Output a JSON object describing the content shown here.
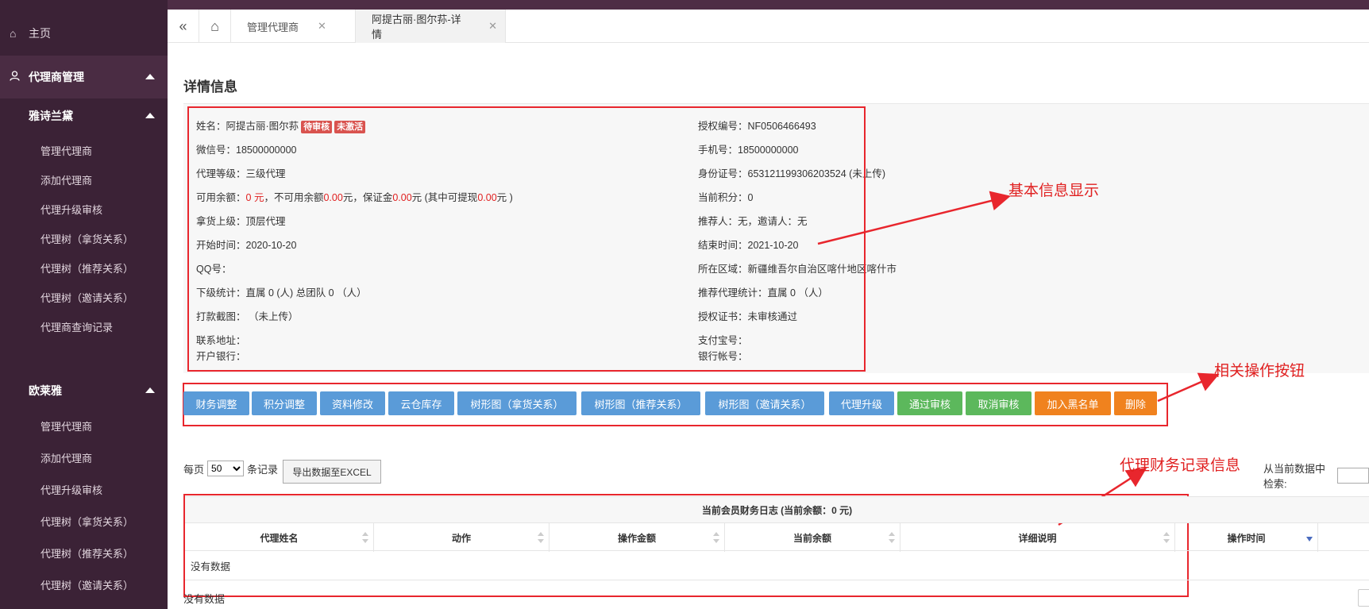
{
  "sidebar": {
    "home": "主页",
    "group": "代理商管理",
    "sub1": {
      "title": "雅诗兰黛",
      "items": [
        "管理代理商",
        "添加代理商",
        "代理升级审核",
        "代理树（拿货关系）",
        "代理树（推荐关系）",
        "代理树（邀请关系）",
        "代理商查询记录"
      ]
    },
    "sub2": {
      "title": "欧莱雅",
      "items": [
        "管理代理商",
        "添加代理商",
        "代理升级审核",
        "代理树（拿货关系）",
        "代理树（推荐关系）",
        "代理树（邀请关系）"
      ]
    }
  },
  "tabs": [
    "管理代理商",
    "阿提古丽·图尔荪-详情"
  ],
  "title": "详情信息",
  "info": {
    "left": {
      "name_label": "姓名：",
      "name": "阿提古丽·图尔荪",
      "badge_audit": "待审核",
      "badge_active": "未激活",
      "wechat": "微信号：18500000000",
      "level": "代理等级：三级代理",
      "balance_pre": "可用余额：",
      "balance_val": "0 元",
      "frozen_pre": "，不可用余额",
      "frozen_val": "0.00",
      "deposit_pre": "元，保证金",
      "deposit_val": "0.00",
      "withdraw_pre": "元 (其中可提现",
      "withdraw_val": "0.00",
      "withdraw_post": "元 )",
      "upline": "拿货上级：顶层代理",
      "start": "开始时间：2020-10-20",
      "qq": "QQ号：",
      "stats": "下级统计：直属 0 (人) 总团队 0 （人）",
      "screenshot": "打款截图：  （未上传）",
      "address": "联系地址：",
      "bank": "开户银行："
    },
    "right": {
      "auth_no": "授权编号：NF0506466493",
      "phone": "手机号：18500000000",
      "idcard": "身份证号：653121199306203524   (未上传)",
      "points": "当前积分：0",
      "referrer": "推荐人：无，邀请人：无",
      "end": "结束时间：2021-10-20",
      "region": "所在区域：新疆维吾尔自治区喀什地区喀什市",
      "ref_stats": "推荐代理统计：直属 0 （人）",
      "cert": "授权证书：未审核通过",
      "alipay": "支付宝号：",
      "bank_account": "银行帐号："
    }
  },
  "buttons": [
    "财务调整",
    "积分调整",
    "资料修改",
    "云仓库存",
    "树形图（拿货关系）",
    "树形图（推荐关系）",
    "树形图（邀请关系）",
    "代理升级",
    "通过审核",
    "取消审核",
    "加入黑名单",
    "删除"
  ],
  "notes": {
    "basic": "基本信息显示",
    "actions": "相关操作按钮",
    "finance": "代理财务记录信息"
  },
  "table": {
    "perpage_pre": "每页",
    "perpage_value": "50",
    "perpage_post": "条记录",
    "export": "导出数据至EXCEL",
    "search_label": "从当前数据中检索:",
    "caption": "当前会员财务日志 (当前余额：0 元)",
    "columns": [
      "代理姓名",
      "动作",
      "操作金额",
      "当前余额",
      "详细说明",
      "操作时间"
    ],
    "empty": "没有数据",
    "footer": "没有数据"
  },
  "colors": {
    "sidebar": "#3b2236",
    "accent_red": "#e8262d",
    "btn_blue": "#5a9bd8",
    "btn_green": "#5cb85c",
    "btn_orange": "#f0821e"
  }
}
